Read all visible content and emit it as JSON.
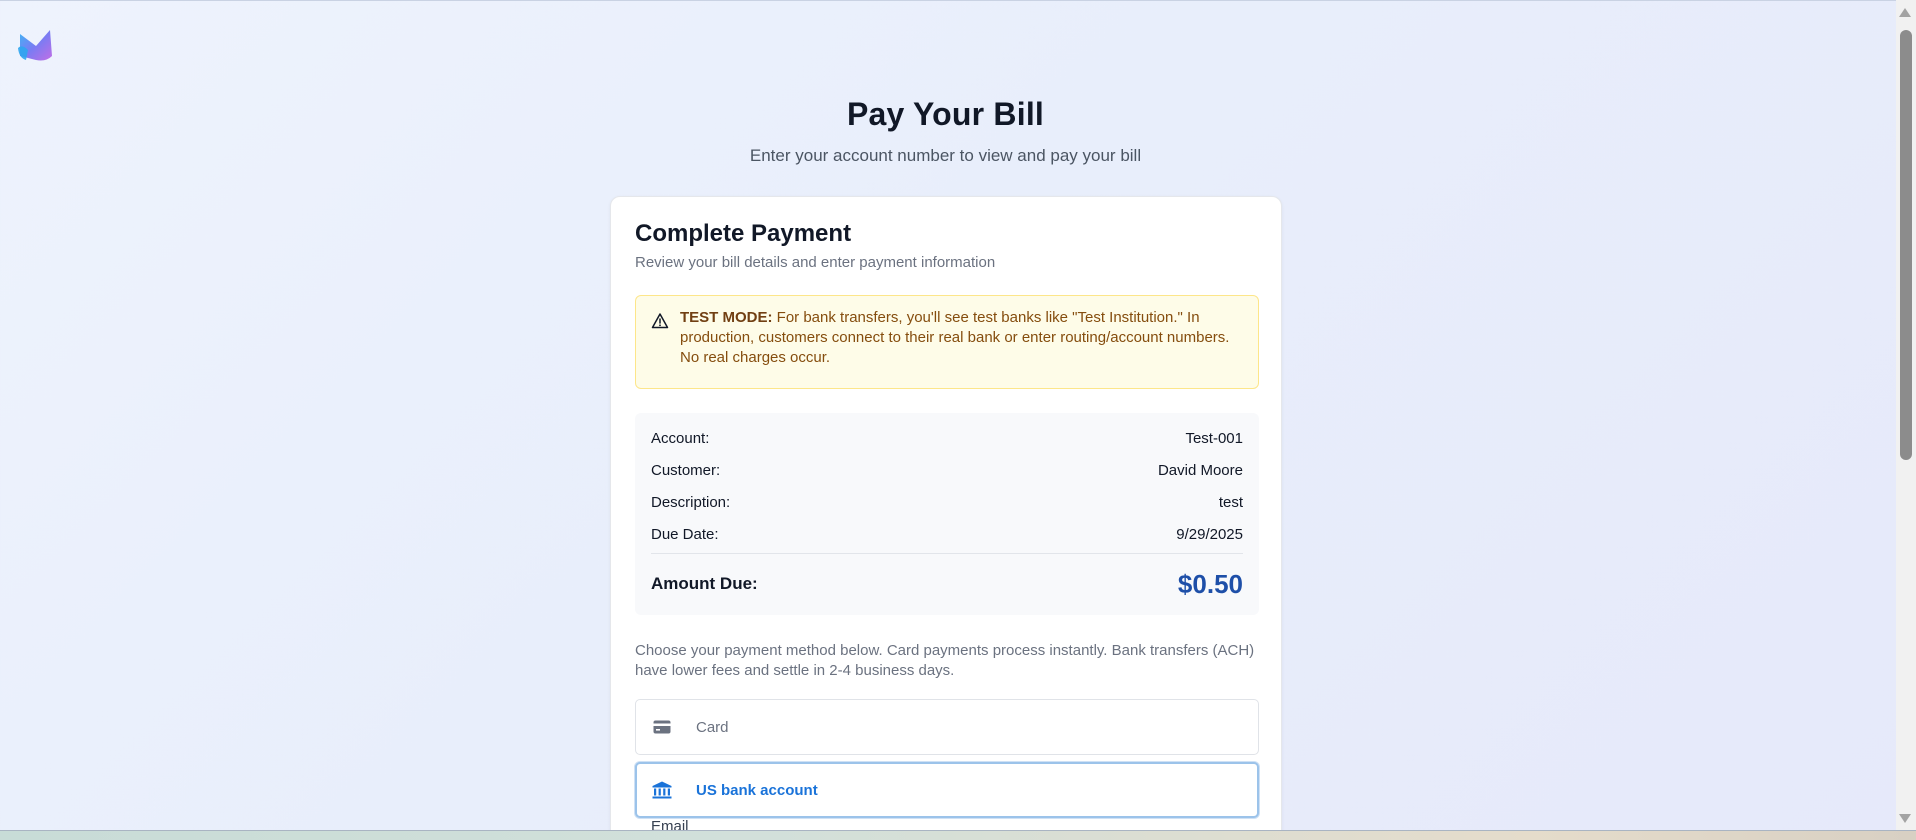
{
  "brand": {
    "logo_icon": "app-logo-icon"
  },
  "header": {
    "title": "Pay Your Bill",
    "subtitle": "Enter your account number to view and pay your bill"
  },
  "payment_card": {
    "title": "Complete Payment",
    "subtitle": "Review your bill details and enter payment information"
  },
  "alert": {
    "icon": "warning-triangle-icon",
    "label": "TEST MODE:",
    "message": " For bank transfers, you'll see test banks like \"Test Institution.\" In production, customers connect to their real bank or enter routing/account numbers. No real charges occur."
  },
  "bill": {
    "account_label": "Account:",
    "account_value": "Test-001",
    "customer_label": "Customer:",
    "customer_value": "David Moore",
    "description_label": "Description:",
    "description_value": "test",
    "due_date_label": "Due Date:",
    "due_date_value": "9/29/2025",
    "amount_label": "Amount Due:",
    "amount_value": "$0.50"
  },
  "payment_methods": {
    "description": "Choose your payment method below. Card payments process instantly. Bank transfers (ACH) have lower fees and settle in 2-4 business days.",
    "options": [
      {
        "label": "Card",
        "icon": "credit-card-icon",
        "selected": false
      },
      {
        "label": "US bank account",
        "icon": "bank-icon",
        "selected": true
      }
    ]
  },
  "email": {
    "label": "Email"
  },
  "colors": {
    "accent": "#1a73d9",
    "amount": "#1e4fa8",
    "alert_bg": "#fefce8",
    "alert_text": "#854d0e"
  }
}
